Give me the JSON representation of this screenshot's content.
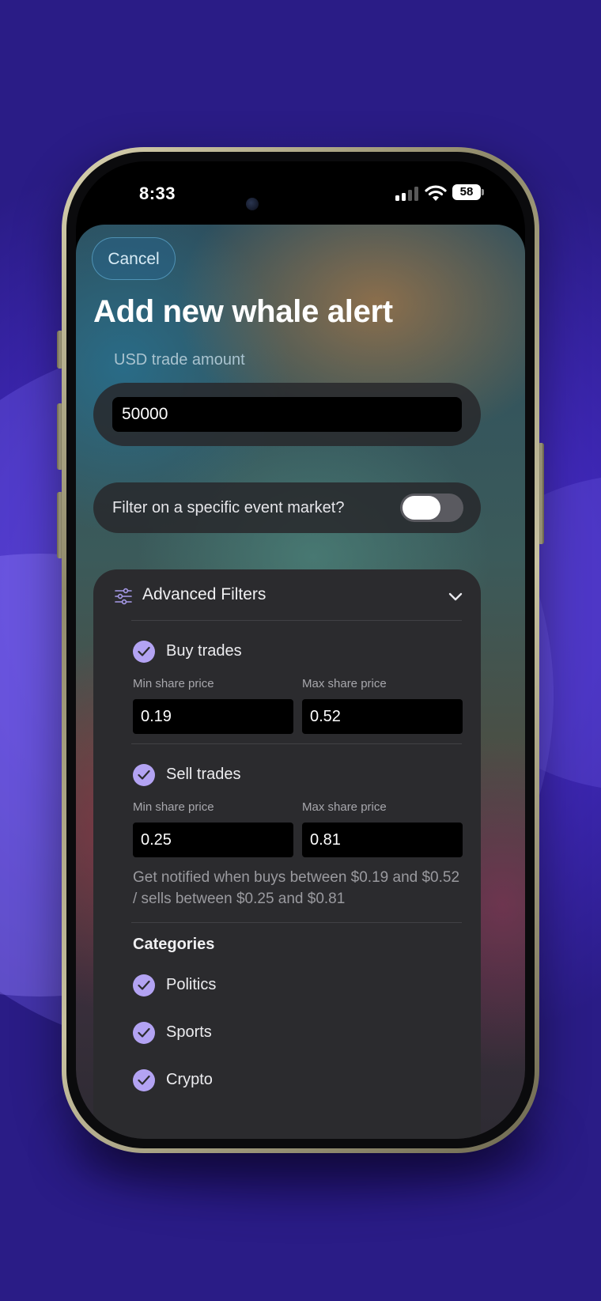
{
  "status_bar": {
    "time": "8:33",
    "battery": "58"
  },
  "sheet": {
    "cancel_label": "Cancel",
    "title": "Add new whale alert",
    "amount_label": "USD trade amount",
    "amount_value": "50000",
    "toggle_label": "Filter on a specific event market?",
    "toggle_on": false
  },
  "advanced_filters": {
    "title": "Advanced Filters",
    "buy": {
      "label": "Buy trades",
      "checked": true,
      "min_label": "Min share price",
      "max_label": "Max share price",
      "min_value": "0.19",
      "max_value": "0.52"
    },
    "sell": {
      "label": "Sell trades",
      "checked": true,
      "min_label": "Min share price",
      "max_label": "Max share price",
      "min_value": "0.25",
      "max_value": "0.81"
    },
    "note": "Get notified when buys between $0.19 and $0.52 / sells between $0.25 and $0.81",
    "categories_title": "Categories",
    "categories": [
      {
        "label": "Politics",
        "checked": true
      },
      {
        "label": "Sports",
        "checked": true
      },
      {
        "label": "Crypto",
        "checked": true
      }
    ]
  },
  "colors": {
    "accent_check": "#b3a3f3",
    "background": "#3f28b8",
    "card": "#2b2b2e"
  }
}
